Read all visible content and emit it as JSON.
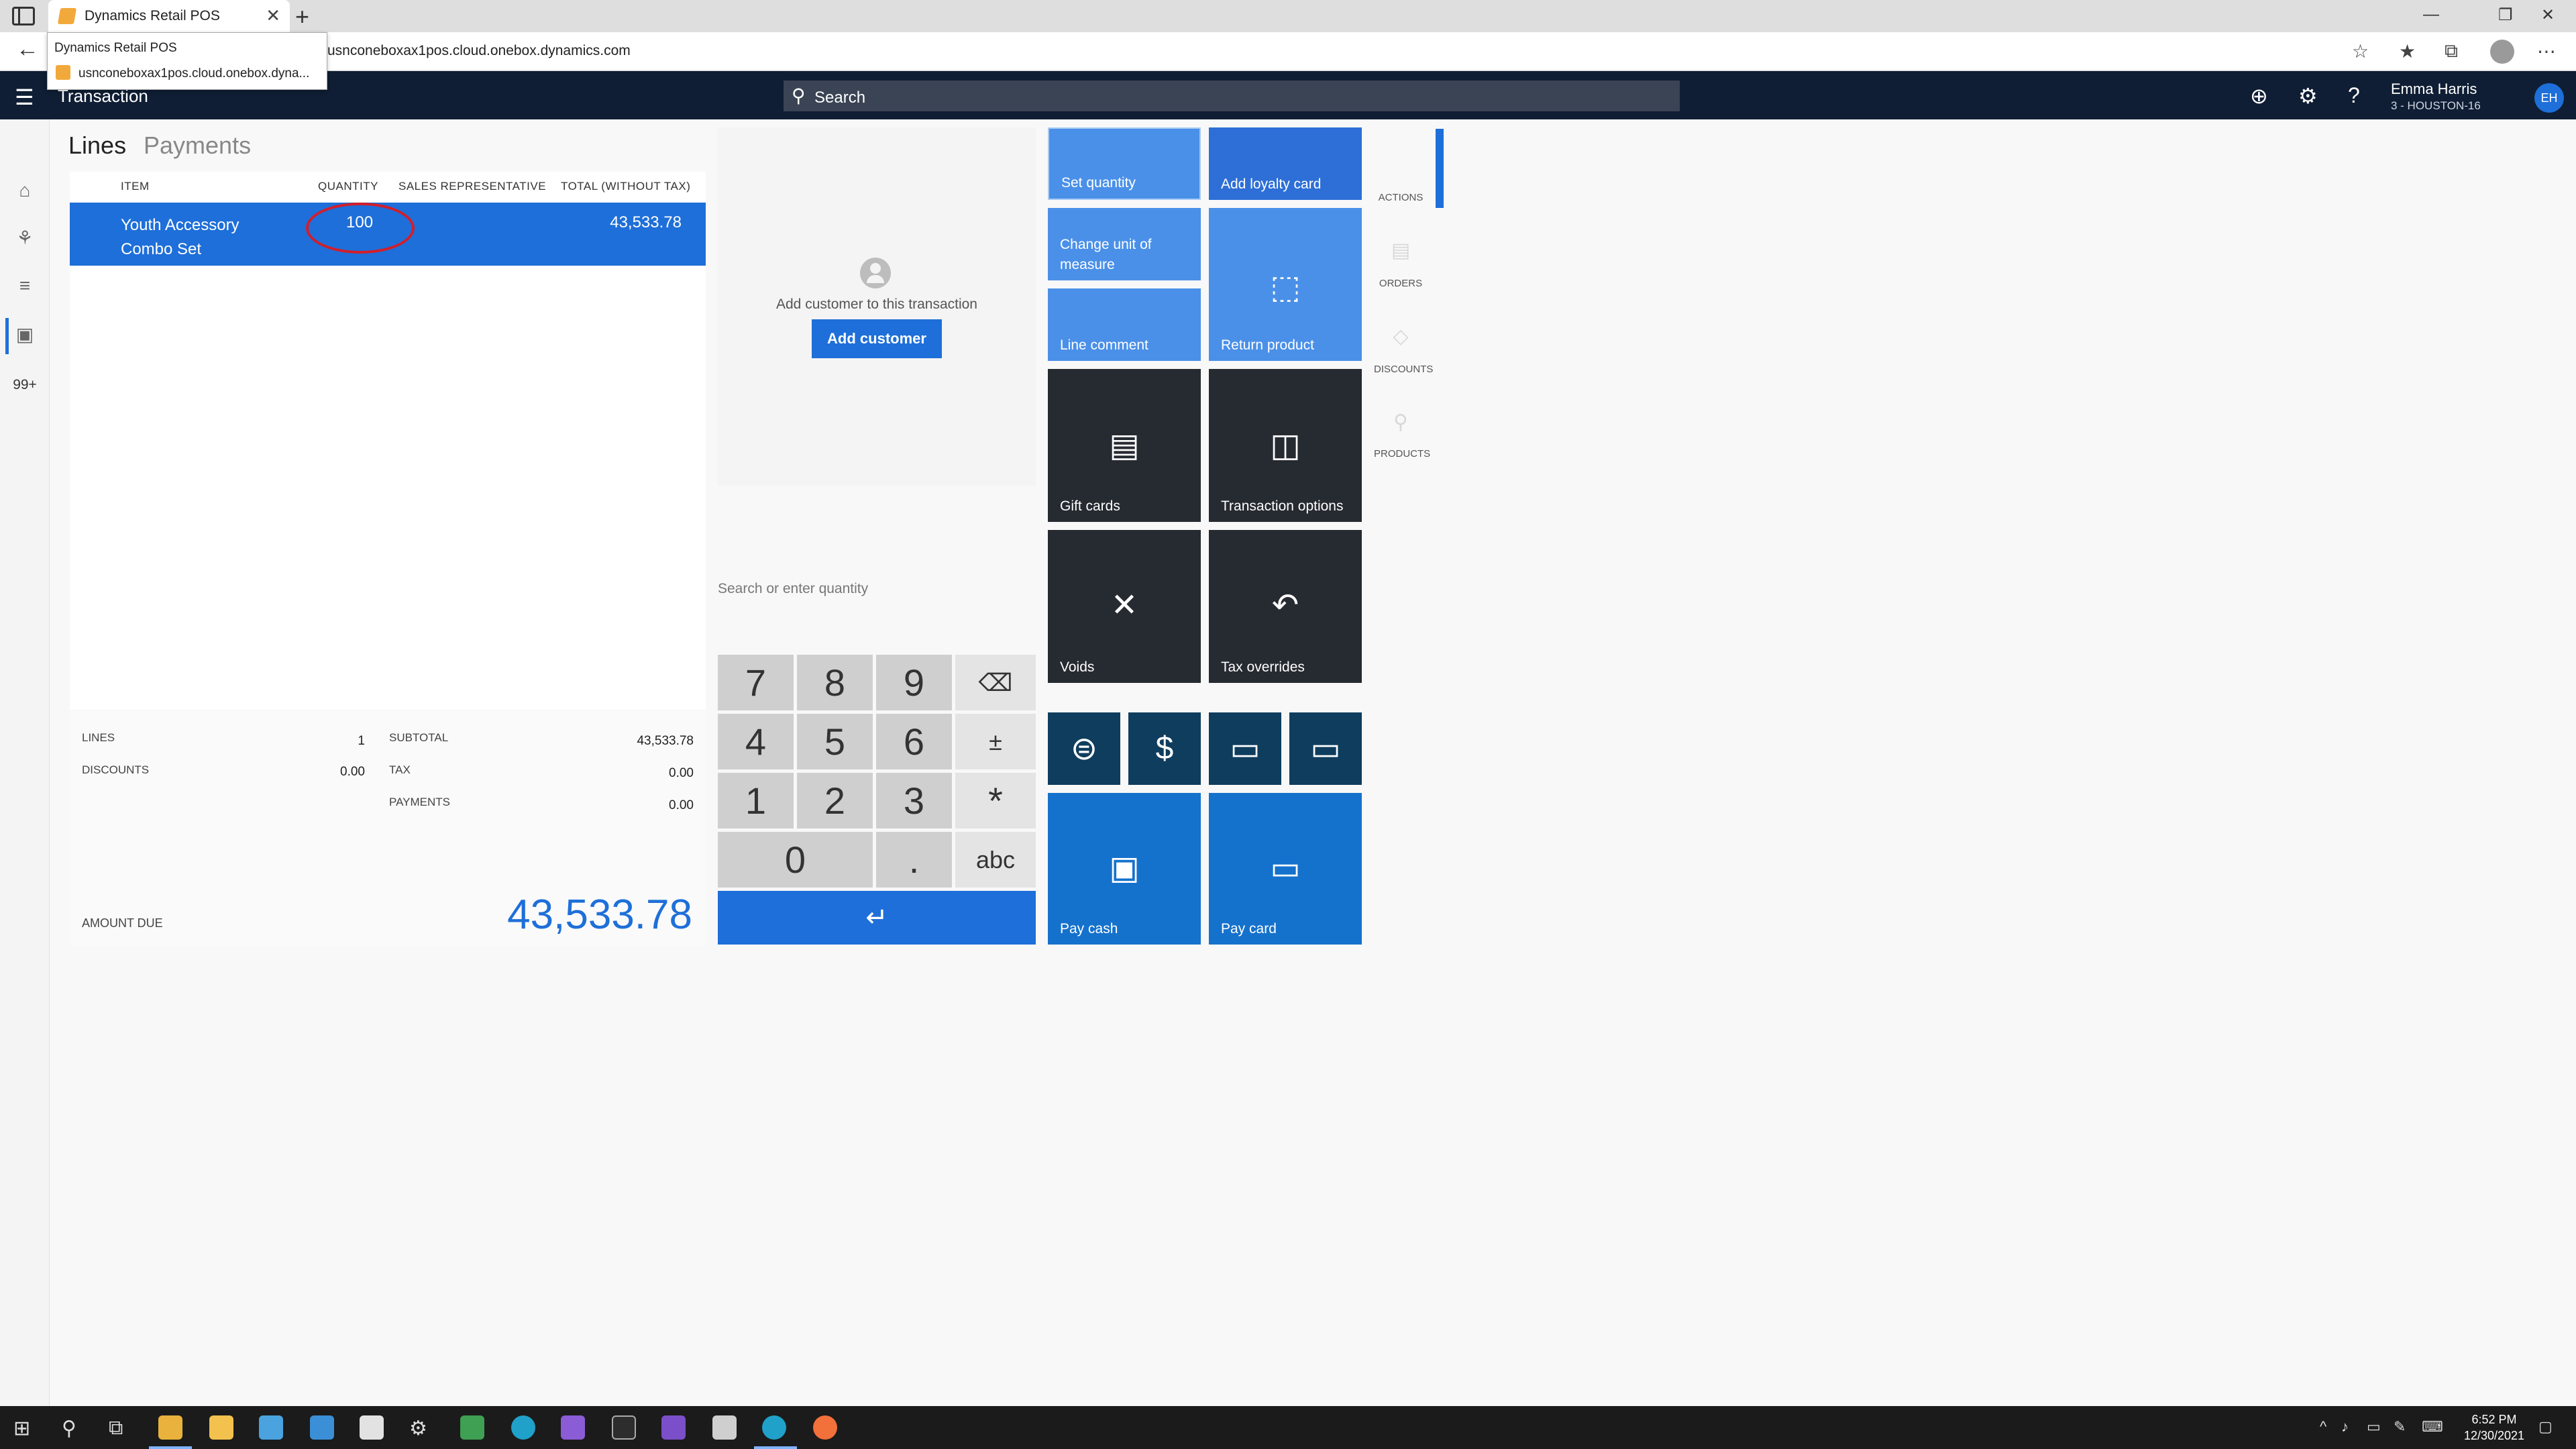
{
  "browser": {
    "tab_title": "Dynamics Retail POS",
    "url": "usnconeboxax1pos.cloud.onebox.dynamics.com",
    "tooltip_title": "Dynamics Retail POS",
    "tooltip_url": "usnconeboxax1pos.cloud.onebox.dyna..."
  },
  "header": {
    "title": "Transaction",
    "search_label": "Search",
    "user_name": "Emma Harris",
    "user_store": "3 - HOUSTON-16",
    "avatar_initials": "EH"
  },
  "rail": {
    "badge": "99+"
  },
  "lines_panel": {
    "tabs": [
      "Lines",
      "Payments"
    ],
    "columns": [
      "ITEM",
      "QUANTITY",
      "SALES REPRESENTATIVE",
      "TOTAL (WITHOUT TAX)"
    ],
    "rows": [
      {
        "item": "Youth Accessory Combo Set",
        "quantity": "100",
        "sales_rep": "",
        "total": "43,533.78"
      }
    ]
  },
  "totals": {
    "lines_label": "LINES",
    "lines_value": "1",
    "discounts_label": "DISCOUNTS",
    "discounts_value": "0.00",
    "subtotal_label": "SUBTOTAL",
    "subtotal_value": "43,533.78",
    "tax_label": "TAX",
    "tax_value": "0.00",
    "payments_label": "PAYMENTS",
    "payments_value": "0.00",
    "amount_due_label": "AMOUNT DUE",
    "amount_due_value": "43,533.78"
  },
  "customer": {
    "prompt": "Add customer to this transaction",
    "button": "Add customer"
  },
  "numpad": {
    "placeholder": "Search or enter quantity",
    "keys": [
      "7",
      "8",
      "9",
      "⌫",
      "4",
      "5",
      "6",
      "±",
      "1",
      "2",
      "3",
      "*",
      "0",
      ".",
      "abc"
    ],
    "enter": "↵"
  },
  "tiles": {
    "set_quantity": "Set quantity",
    "add_loyalty_card": "Add loyalty card",
    "change_unit_of_measure": "Change unit of measure",
    "return_product": "Return product",
    "line_comment": "Line comment",
    "gift_cards": "Gift cards",
    "transaction_options": "Transaction options",
    "voids": "Voids",
    "tax_overrides": "Tax overrides",
    "pay_cash": "Pay cash",
    "pay_card": "Pay card"
  },
  "side_nav": [
    "ACTIONS",
    "ORDERS",
    "DISCOUNTS",
    "PRODUCTS"
  ],
  "taskbar": {
    "time": "6:52 PM",
    "date": "12/30/2021"
  },
  "colors": {
    "accent": "#1e6fd9",
    "header_bg": "#0f1e34",
    "tile_light_blue": "#4a90e8",
    "tile_dark": "#262a31",
    "tile_navy": "#0f3d5e",
    "annotation_red": "#d21e2b"
  }
}
